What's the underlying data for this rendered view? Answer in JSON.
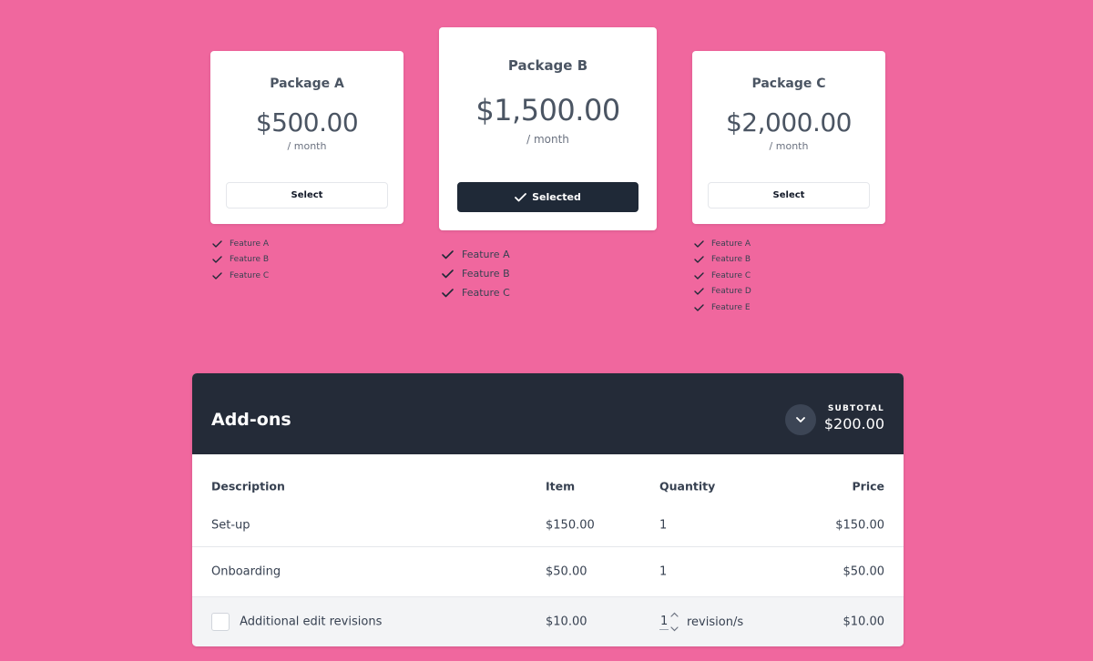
{
  "packages": [
    {
      "name": "Package A",
      "price": "$500.00",
      "period": "/ month",
      "button": "Select",
      "features": [
        "Feature A",
        "Feature B",
        "Feature C"
      ]
    },
    {
      "name": "Package B",
      "price": "$1,500.00",
      "period": "/ month",
      "button": "Selected",
      "features": [
        "Feature A",
        "Feature B",
        "Feature C"
      ]
    },
    {
      "name": "Package C",
      "price": "$2,000.00",
      "period": "/ month",
      "button": "Select",
      "features": [
        "Feature A",
        "Feature B",
        "Feature C",
        "Feature D",
        "Feature E"
      ]
    }
  ],
  "selected_package": "Package B",
  "addons": {
    "title": "Add-ons",
    "subtotal_label": "SUBTOTAL",
    "subtotal": "$200.00",
    "columns": [
      "Description",
      "Item",
      "Quantity",
      "Price"
    ],
    "rows": [
      {
        "description": "Set-up",
        "item": "$150.00",
        "quantity": "1",
        "price": "$150.00"
      },
      {
        "description": "Onboarding",
        "item": "$50.00",
        "quantity": "1",
        "price": "$50.00"
      },
      {
        "description": "Additional edit revisions",
        "item": "$10.00",
        "quantity": "1",
        "unit": "revision/s",
        "price": "$10.00",
        "checked": false
      }
    ]
  },
  "colors": {
    "background": "#f0679e",
    "dark": "#242b38",
    "card": "#ffffff"
  },
  "icons": {
    "check": "check-icon",
    "chevron": "chevron-down-icon"
  }
}
